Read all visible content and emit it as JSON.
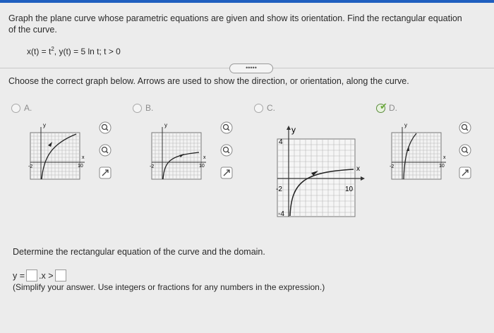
{
  "question": {
    "line1": "Graph the plane curve whose parametric equations are given and show its orientation. Find the rectangular equation",
    "line2": "of the curve.",
    "eq_x": "x(t) = t",
    "eq_exp": "2",
    "eq_rest": ", y(t) = 5 ln t; t > 0"
  },
  "pill_label": "•••••",
  "choose": "Choose the correct graph below. Arrows are used to show the direction, or orientation, along the curve.",
  "options": [
    {
      "label": "A."
    },
    {
      "label": "B."
    },
    {
      "label": "C."
    },
    {
      "label": "D."
    }
  ],
  "graph_labels": {
    "y": "y",
    "x": "x",
    "neg2": "-2",
    "ten": "10",
    "four": "4",
    "negfour": "-4"
  },
  "determine": "Determine the rectangular equation of the curve and the domain.",
  "answer": {
    "y_label": "y =",
    "sep": ".",
    "x_label": "x >"
  },
  "simplify": "(Simplify your answer. Use integers or fractions for any numbers in the expression.)",
  "colors": {
    "accent": "#1f5fbf",
    "check": "#6aa83a"
  }
}
